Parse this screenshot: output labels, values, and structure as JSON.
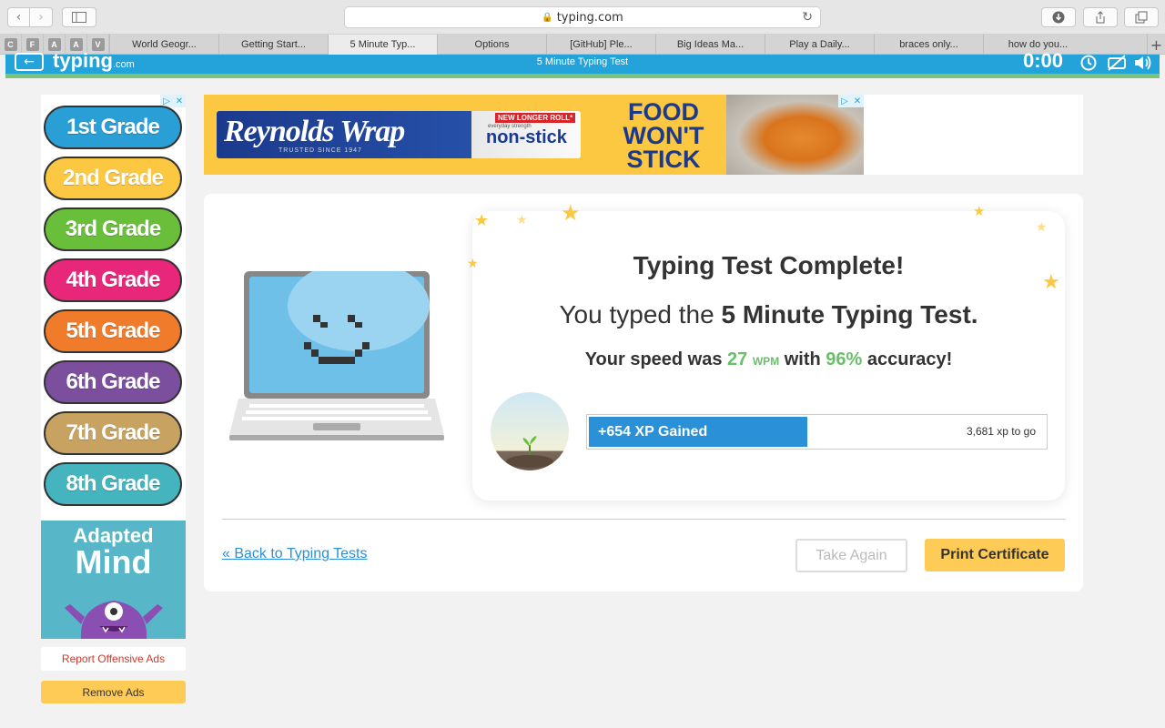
{
  "browser": {
    "url": "typing.com",
    "pinned": [
      "C",
      "F",
      "A",
      "A",
      "V"
    ],
    "tabs": [
      {
        "label": "World Geogr..."
      },
      {
        "label": "Getting Start..."
      },
      {
        "label": "5 Minute Typ..."
      },
      {
        "label": "Options"
      },
      {
        "label": "[GitHub] Ple..."
      },
      {
        "label": "Big Ideas Ma..."
      },
      {
        "label": "Play a Daily..."
      },
      {
        "label": "braces only..."
      },
      {
        "label": "how do you..."
      }
    ],
    "active_tab": 2
  },
  "header": {
    "logo": "typing",
    "logo_suffix": ".com",
    "title": "5 Minute Typing Test",
    "timer": "0:00"
  },
  "left_ad": {
    "grades": [
      {
        "label": "1st Grade",
        "color": "#2a9fd6"
      },
      {
        "label": "2nd Grade",
        "color": "#fcc741"
      },
      {
        "label": "3rd Grade",
        "color": "#6abf3a"
      },
      {
        "label": "4th Grade",
        "color": "#e8267a"
      },
      {
        "label": "5th Grade",
        "color": "#f07b2a"
      },
      {
        "label": "6th Grade",
        "color": "#7b4f9e"
      },
      {
        "label": "7th Grade",
        "color": "#c8a260"
      },
      {
        "label": "8th Grade",
        "color": "#44b5bf"
      }
    ],
    "brand_line1": "Adapted",
    "brand_line2": "Mind",
    "report_label": "Report Offensive Ads",
    "remove_label": "Remove Ads"
  },
  "banner_ad": {
    "brand": "Reynolds Wrap",
    "tagline": "TRUSTED SINCE 1947",
    "badge": "NEW LONGER ROLL*",
    "product_small": "everyday strength",
    "product": "non-stick",
    "headline": "FOOD WON'T STICK"
  },
  "result": {
    "title": "Typing Test Complete!",
    "sub_prefix": "You typed the ",
    "test_name": "5 Minute Typing Test.",
    "speed_prefix": "Your speed was ",
    "wpm": "27",
    "wpm_unit": "WPM",
    "speed_mid": " with ",
    "accuracy": "96%",
    "speed_suffix": " accuracy!",
    "xp_gained": "+654 XP Gained",
    "xp_to_go": "3,681 xp to go",
    "xp_progress": 0.5
  },
  "actions": {
    "back": "« Back to Typing Tests",
    "take_again": "Take Again",
    "print": "Print Certificate"
  }
}
